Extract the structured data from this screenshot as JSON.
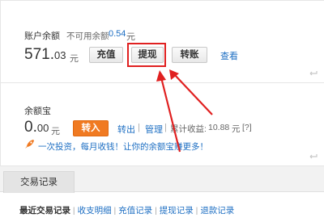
{
  "account": {
    "balance_label": "账户余额",
    "unavailable_label": "不可用余额",
    "unavailable_value": "0.54",
    "unavailable_unit": "元",
    "balance_int": "571.",
    "balance_dec": "03",
    "balance_unit": "元",
    "buttons": {
      "recharge": "充值",
      "withdraw": "提现",
      "transfer": "转账"
    },
    "view_link": "查看"
  },
  "yuebao": {
    "title": "余额宝",
    "amount_int": "0.",
    "amount_dec": "00",
    "amount_unit": "元",
    "transfer_in_button": "转入",
    "transfer_out_link": "转出",
    "separator": "|",
    "manage_link": "管理",
    "earnings_label": "累计收益:",
    "earnings_value": "10.88",
    "earnings_unit": "元",
    "help_link": "[?]",
    "promo_text": "一次投资，每月收钱！让你的余额宝赚更多！"
  },
  "tabs": {
    "active_tab": "交易记录"
  },
  "subnav": {
    "items": [
      "最近交易记录",
      "收支明细",
      "充值记录",
      "提现记录",
      "退款记录"
    ],
    "separator": "|"
  },
  "colors": {
    "link_blue": "#1e6fc3",
    "orange_button": "#f07a22",
    "highlight_red": "#e02020",
    "arrow_red": "#e02020"
  },
  "icons": [
    "refresh-icon",
    "rocket-icon",
    "annotation-arrow"
  ]
}
